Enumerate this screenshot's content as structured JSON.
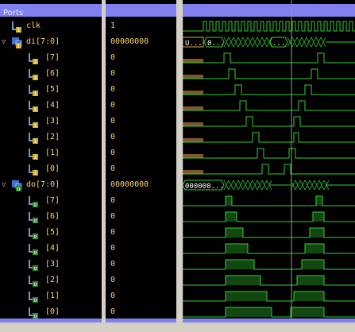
{
  "panel": {
    "title": "Ports"
  },
  "signals": [
    {
      "name": "clk",
      "value": "1",
      "kind": "in",
      "level": 0
    },
    {
      "name": "di[7:0]",
      "value": "00000000",
      "kind": "in-bus",
      "level": 0,
      "expanded": true
    },
    {
      "name": "[7]",
      "value": "0",
      "kind": "in",
      "level": 1
    },
    {
      "name": "[6]",
      "value": "0",
      "kind": "in",
      "level": 1
    },
    {
      "name": "[5]",
      "value": "0",
      "kind": "in",
      "level": 1
    },
    {
      "name": "[4]",
      "value": "0",
      "kind": "in",
      "level": 1
    },
    {
      "name": "[3]",
      "value": "0",
      "kind": "in",
      "level": 1
    },
    {
      "name": "[2]",
      "value": "0",
      "kind": "in",
      "level": 1
    },
    {
      "name": "[1]",
      "value": "0",
      "kind": "in",
      "level": 1
    },
    {
      "name": "[0]",
      "value": "0",
      "kind": "in",
      "level": 1
    },
    {
      "name": "do[7:0]",
      "value": "00000000",
      "kind": "out-bus",
      "level": 0,
      "expanded": true
    },
    {
      "name": "[7]",
      "value": "0",
      "kind": "out",
      "level": 1
    },
    {
      "name": "[6]",
      "value": "0",
      "kind": "out",
      "level": 1
    },
    {
      "name": "[5]",
      "value": "0",
      "kind": "out",
      "level": 1
    },
    {
      "name": "[4]",
      "value": "0",
      "kind": "out",
      "level": 1
    },
    {
      "name": "[3]",
      "value": "0",
      "kind": "out",
      "level": 1
    },
    {
      "name": "[2]",
      "value": "0",
      "kind": "out",
      "level": 1
    },
    {
      "name": "[1]",
      "value": "0",
      "kind": "out",
      "level": 1
    },
    {
      "name": "[0]",
      "value": "0",
      "kind": "out",
      "level": 1
    }
  ],
  "bus_labels": {
    "di_first": "U...",
    "di_second": "0...",
    "di_ellipsis": "...",
    "do_first": "000000..."
  },
  "colors": {
    "wave": "#33cc33",
    "value_text": "#ffd36a",
    "header": "#8080f0",
    "undefined": "#e8a040"
  }
}
